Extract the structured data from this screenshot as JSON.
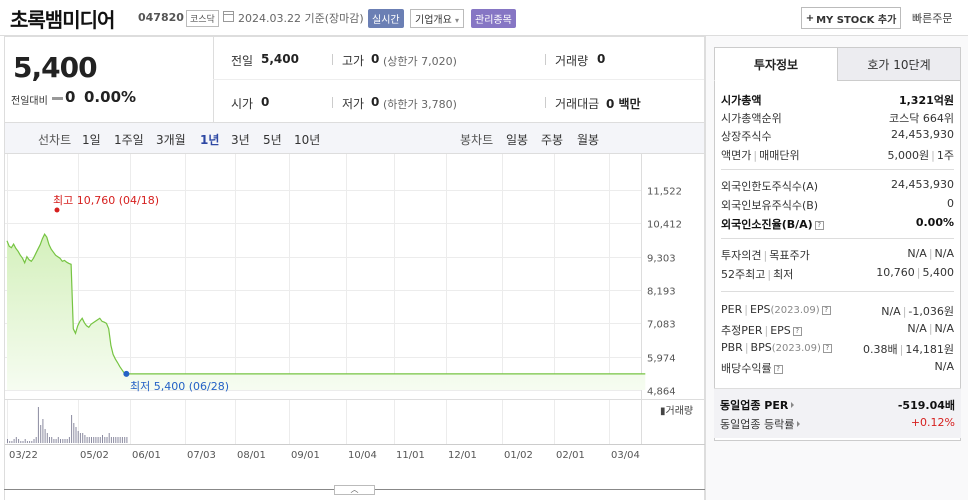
{
  "header": {
    "stock_name": "초록뱀미디어",
    "stock_code": "047820",
    "market": "코스닥",
    "date": "2024.03.22 기준(장마감)",
    "realtime": "실시간",
    "company_overview": "기업개요",
    "company_overview_arrow": "▾",
    "admin_issue": "관리종목",
    "mystock_plus": "+",
    "mystock_label": "MY STOCK 추가",
    "quick_order": "빠른주문"
  },
  "quote": {
    "price": "5,400",
    "change_label": "전일대비",
    "change_value": "0",
    "change_rate": "0.00%",
    "prev_close_label": "전일",
    "prev_close": "5,400",
    "high_label": "고가",
    "high": "0",
    "upper_limit": "(상한가 7,020)",
    "volume_label": "거래량",
    "volume": "0",
    "open_label": "시가",
    "open": "0",
    "low_label": "저가",
    "low": "0",
    "lower_limit": "(하한가 3,780)",
    "trade_amount_label": "거래대금",
    "trade_amount": "0 백만"
  },
  "chart_tabs": {
    "line_chart_label": "선차트",
    "line_periods": [
      "1일",
      "1주일",
      "3개월",
      "1년",
      "3년",
      "5년",
      "10년"
    ],
    "active_period": "1년",
    "candle_chart_label": "봉차트",
    "candle_periods": [
      "일봉",
      "주봉",
      "월봉"
    ]
  },
  "colors": {
    "line": "#76c442",
    "fill_top": "#d4f0bc",
    "fill_bottom": "#f6fcf1",
    "high_marker": "#d6201f",
    "low_marker": "#2462c6",
    "volume_bar": "#8a8aa0",
    "accent": "#2c47a3"
  },
  "chart_data": {
    "type": "area",
    "y_ticks": [
      "11,522",
      "10,412",
      "9,303",
      "8,193",
      "7,083",
      "5,974",
      "4,864"
    ],
    "ylim": [
      4864,
      11522
    ],
    "x_ticks": [
      "03/22",
      "05/02",
      "06/01",
      "07/03",
      "08/01",
      "09/01",
      "10/04",
      "11/01",
      "12/01",
      "01/02",
      "02/01",
      "03/04"
    ],
    "high_label": "최고 10,760 (04/18)",
    "low_label": "최저 5,400 (06/28)",
    "volume_label": "거래량",
    "series": [
      {
        "values": [
          9830,
          9650,
          9600,
          9720,
          9580,
          9480,
          9350,
          9250,
          9100,
          9300,
          9200,
          9150,
          9250,
          9400,
          9550,
          9700,
          9900,
          10050,
          9950,
          9700,
          9550,
          9450,
          9350,
          9300,
          9250,
          9150,
          9180,
          9120,
          9080,
          9050,
          6900,
          6750,
          7000,
          7150,
          7250,
          7100,
          7000,
          6950,
          7050,
          7100,
          7150,
          7200,
          7250,
          7150,
          7120,
          7080,
          6900,
          6350,
          6050,
          5900,
          5780,
          5650,
          5540,
          5430,
          5400
        ]
      }
    ],
    "flat_value": 5400,
    "flat_until_day": 369,
    "volume": [
      2,
      1,
      1,
      2,
      3,
      2,
      1,
      1,
      2,
      1,
      1,
      1,
      2,
      3,
      18,
      9,
      12,
      7,
      5,
      3,
      3,
      2,
      2,
      3,
      2,
      2,
      2,
      2,
      3,
      14,
      10,
      8,
      6,
      5,
      5,
      4,
      3,
      3,
      3,
      3,
      3,
      3,
      3,
      4,
      3,
      3,
      5,
      3,
      3,
      3,
      3,
      3,
      3,
      3,
      3
    ]
  },
  "invest_info": {
    "tab_active": "투자정보",
    "tab_inactive": "호가 10단계",
    "market_cap_label": "시가총액",
    "market_cap": "1,321억원",
    "market_cap_rank_label": "시가총액순위",
    "market_cap_rank": "코스닥 664위",
    "shares_label": "상장주식수",
    "shares": "24,453,930",
    "par_label": "액면가",
    "unit_label": "매매단위",
    "par_value": "5,000원",
    "unit_value": "1주",
    "foreign_limit_label": "외국인한도주식수(A)",
    "foreign_limit": "24,453,930",
    "foreign_hold_label": "외국인보유주식수(B)",
    "foreign_hold": "0",
    "foreign_rate_label": "외국인소진율(B/A)",
    "foreign_rate": "0.00%",
    "opinion_label": "투자의견",
    "target_label": "목표주가",
    "opinion_value": "N/A",
    "target_value": "N/A",
    "w52_high_label": "52주최고",
    "w52_low_label": "최저",
    "w52_high": "10,760",
    "w52_low": "5,400",
    "per_label": "PER",
    "eps_label": "EPS",
    "eps_period": "(2023.09)",
    "per_value": "N/A",
    "eps_value": "-1,036원",
    "est_per_label": "추정PER",
    "est_eps_label": "EPS",
    "est_per_value": "N/A",
    "est_eps_value": "N/A",
    "pbr_label": "PBR",
    "bps_label": "BPS",
    "bps_period": "(2023.09)",
    "pbr_value": "0.38배",
    "bps_value": "14,181원",
    "dividend_label": "배당수익률",
    "dividend_value": "N/A",
    "industry_per_label": "동일업종 PER",
    "industry_per": "-519.04배",
    "industry_change_label": "동일업종 등락률",
    "industry_change": "+0.12%"
  }
}
